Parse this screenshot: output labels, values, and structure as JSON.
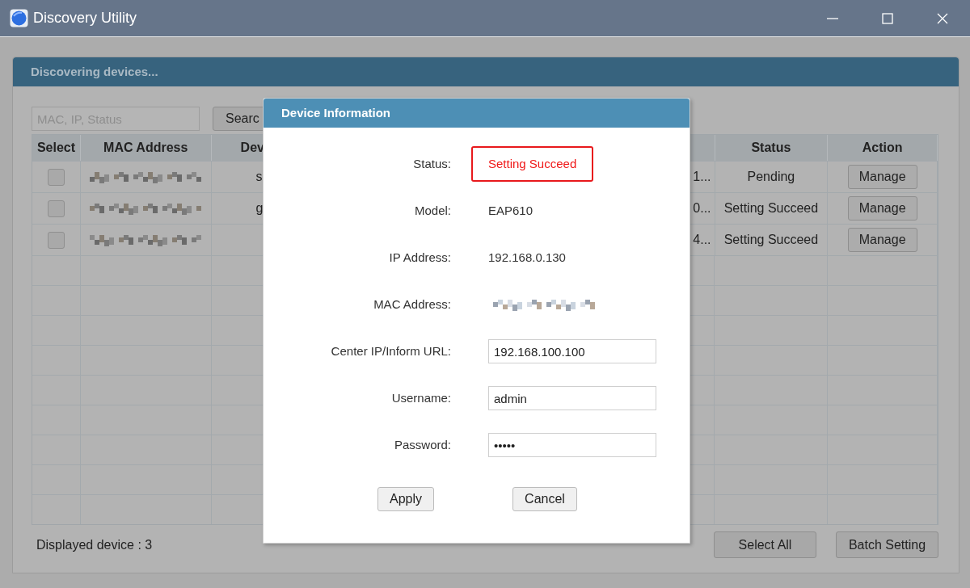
{
  "window": {
    "title": "Discovery Utility"
  },
  "panel": {
    "title": "Discovering devices...",
    "search": {
      "placeholder": "MAC, IP, Status"
    },
    "search_button": "Searc",
    "table": {
      "columns": [
        "Select",
        "MAC Address",
        "Dev",
        "Status",
        "Action"
      ],
      "rows": [
        {
          "checked": false,
          "column_3": "s",
          "column_4": "1...",
          "status": "Pending",
          "action": "Manage"
        },
        {
          "checked": false,
          "column_3": "g",
          "column_4": "0...",
          "status": "Setting Succeed",
          "action": "Manage"
        },
        {
          "checked": false,
          "column_4": "4...",
          "status": "Setting Succeed",
          "action": "Manage"
        }
      ]
    },
    "footer": {
      "count": "Displayed device : 3",
      "buttons": [
        "Select All",
        "Batch Setting"
      ]
    }
  },
  "dialog": {
    "title": "Device Information",
    "fields": [
      {
        "kind": "status",
        "label": "Status:",
        "value": "Setting Succeed",
        "highlighted": true
      },
      {
        "kind": "text",
        "label": "Model:",
        "value": "EAP610"
      },
      {
        "kind": "text",
        "label": "IP Address:",
        "value": "192.168.0.130"
      },
      {
        "kind": "redacted",
        "label": "MAC Address:"
      },
      {
        "kind": "input",
        "label": "Center IP/Inform URL:",
        "value": "192.168.100.100"
      },
      {
        "kind": "input",
        "label": "Username:",
        "value": "admin"
      },
      {
        "kind": "input",
        "label": "Password:",
        "value": "•••••"
      }
    ],
    "buttons": [
      "Apply",
      "Cancel"
    ]
  }
}
